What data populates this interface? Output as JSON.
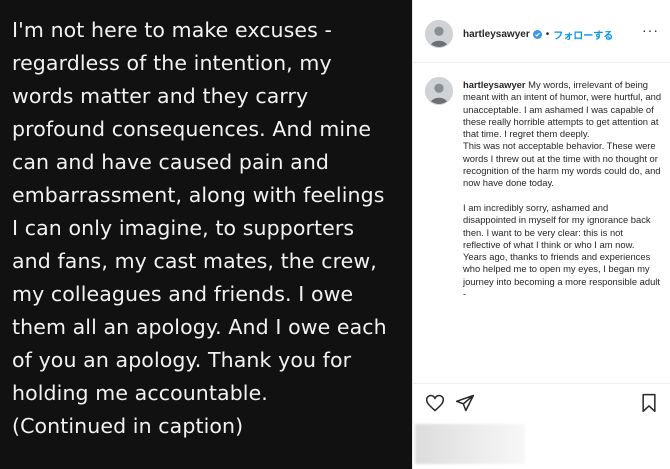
{
  "post_image": {
    "statement_lines": [
      "I'm not here to make excuses -",
      "regardless of the intention, my",
      "words matter and they carry",
      "profound consequences. And mine",
      "can and have caused pain and",
      "embarrassment, along with feelings",
      "I can only imagine, to supporters",
      "and fans, my cast mates, the crew,",
      "my colleagues and friends. I owe",
      "them all an apology. And I owe each",
      "of you an apology. Thank you for",
      "holding me accountable.",
      "(Continued in caption)"
    ]
  },
  "header": {
    "username": "hartleysawyer",
    "separator": "•",
    "follow_label": "フォローする",
    "more_label": "···"
  },
  "caption": {
    "username": "hartleysawyer",
    "text": " My words, irrelevant of being meant with an intent of humor, were hurtful, and unacceptable. I am ashamed I was capable of these really horrible attempts to get attention at that time. I regret them deeply.\nThis was not acceptable behavior. These were words I threw out at the time with no thought or recognition of the harm my words could do, and now have done today.\n\nI am incredibly sorry, ashamed and disappointed in myself for my ignorance back then. I want to be very clear: this is not reflective of what I think or who I am now.\nYears ago, thanks to friends and experiences who helped me to open my eyes, I began my journey into becoming a more responsible adult -"
  },
  "icons": {
    "verified": "verified-badge-icon",
    "like": "heart-icon",
    "share": "paper-plane-icon",
    "save": "bookmark-icon",
    "more": "more-dots-icon"
  },
  "colors": {
    "verified": "#3897f0",
    "follow": "#0095f6",
    "image_bg": "#111111"
  }
}
